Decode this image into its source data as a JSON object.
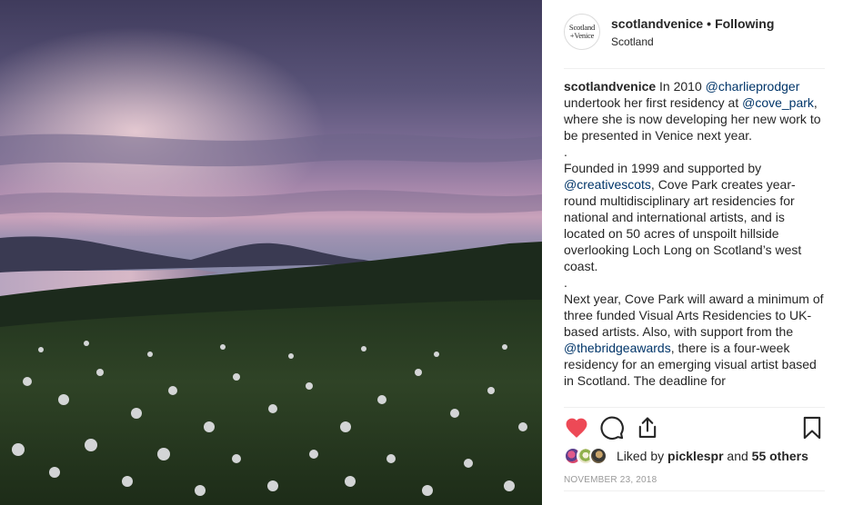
{
  "photo": {
    "alt_description_icon": "landscape-photo"
  },
  "header": {
    "avatar_line1": "Scotland",
    "avatar_line2": "+Venice",
    "username": "scotlandvenice",
    "separator": "•",
    "follow_status": "Following",
    "location": "Scotland"
  },
  "caption": {
    "segments": [
      {
        "type": "user",
        "text": "scotlandvenice"
      },
      {
        "type": "text",
        "text": " In 2010 "
      },
      {
        "type": "mention",
        "text": "@charlieprodger"
      },
      {
        "type": "text",
        "text": " undertook her first residency at "
      },
      {
        "type": "mention",
        "text": "@cove_park"
      },
      {
        "type": "text",
        "text": ", where she is now developing her new work to be presented in Venice next year.\n.\nFounded in 1999 and supported by "
      },
      {
        "type": "mention",
        "text": "@creativescots"
      },
      {
        "type": "text",
        "text": ", Cove Park creates year-round multidisciplinary art residencies for national and international artists, and is located on 50 acres of unspoilt hillside overlooking Loch Long on Scotland’s west coast.\n.\nNext year, Cove Park will award a minimum of three funded Visual Arts Residencies to UK-based artists. Also, with support from the "
      },
      {
        "type": "mention",
        "text": "@thebridgeawards"
      },
      {
        "type": "text",
        "text": ", there is a four-week residency for an emerging visual artist based in Scotland. The deadline for"
      }
    ]
  },
  "actions": {
    "like_icon": "heart-filled-icon",
    "comment_icon": "comment-icon",
    "share_icon": "share-icon",
    "save_icon": "bookmark-icon",
    "like_color": "#ed4956"
  },
  "likes": {
    "prefix": "Liked by ",
    "first_liker": "picklespr",
    "and": " and ",
    "others": "55 others"
  },
  "date": "NOVEMBER 23, 2018"
}
